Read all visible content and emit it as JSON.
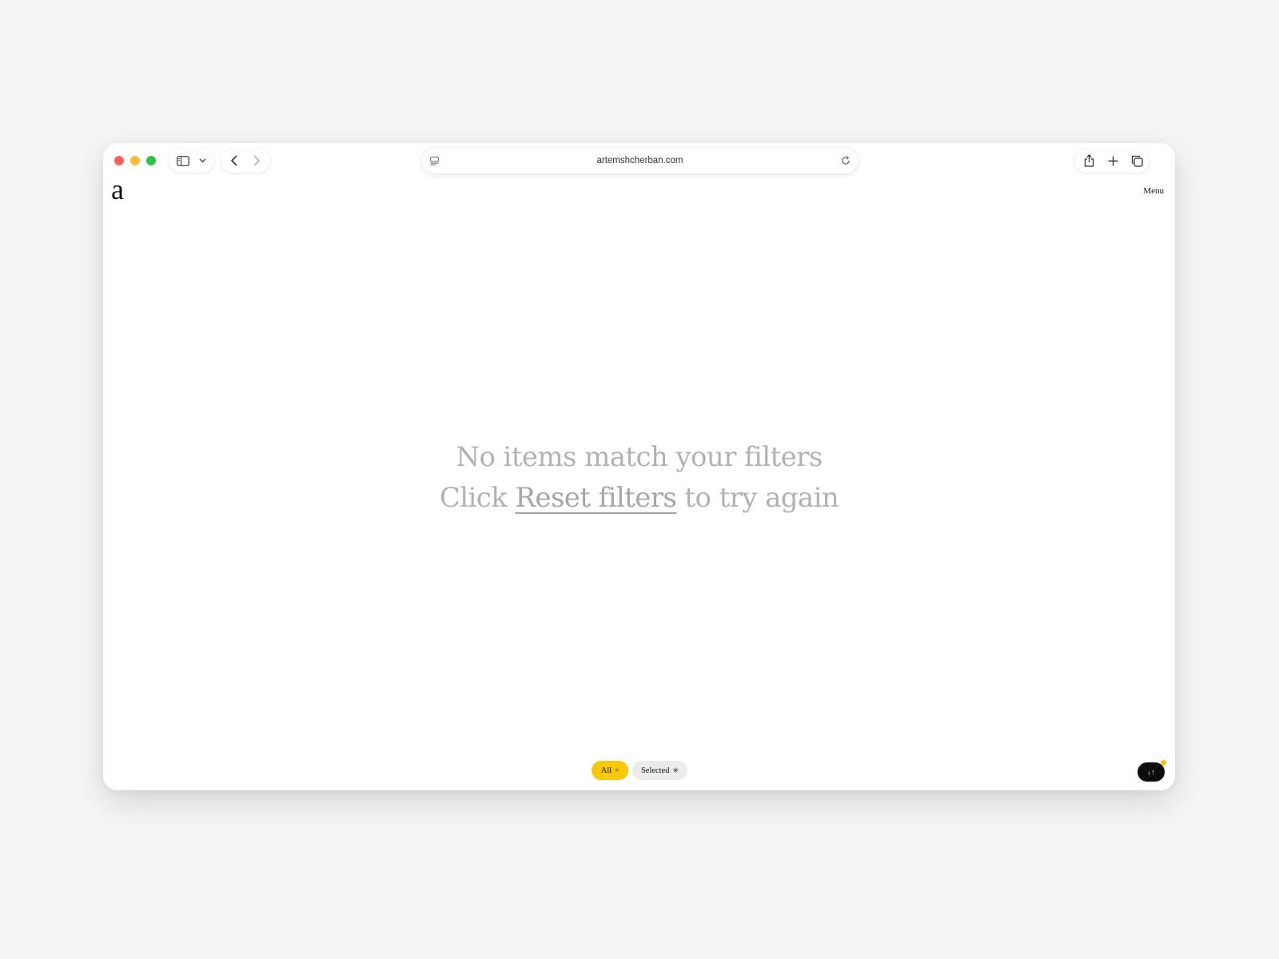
{
  "browser": {
    "url": "artemshcherban.com",
    "traffic_colors": {
      "close": "#ff5f57",
      "minimize": "#febc2e",
      "maximize": "#28c840"
    }
  },
  "site": {
    "logo": "a",
    "menu_label": "Menu"
  },
  "empty_state": {
    "line1": "No items match your filters",
    "line2_prefix": "Click ",
    "reset_link": "Reset filters",
    "line2_suffix": " to try again"
  },
  "filters": {
    "all_label": "All",
    "all_icon": "=",
    "selected_label": "Selected",
    "selected_icon": "✳",
    "active_color": "#f8c800"
  },
  "sort_button": {
    "icon": "↓↑"
  }
}
